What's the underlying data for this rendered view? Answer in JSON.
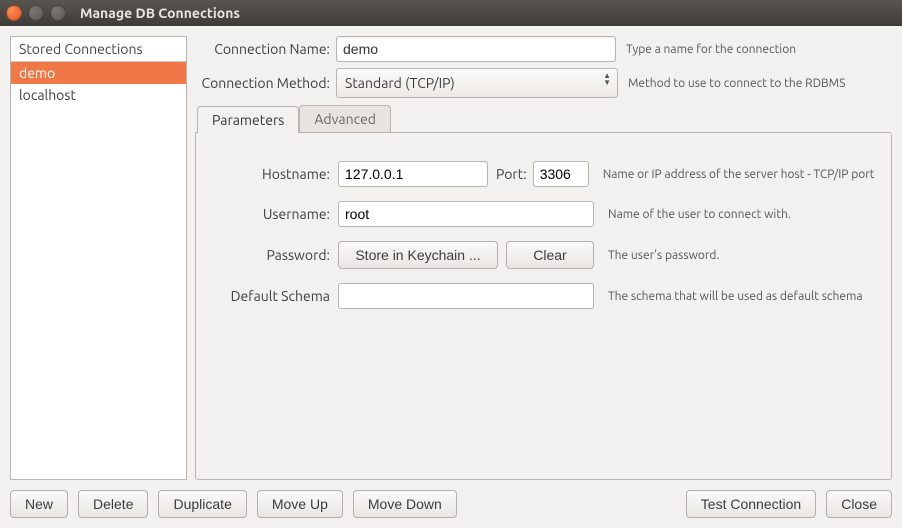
{
  "window": {
    "title": "Manage DB Connections"
  },
  "sidebar": {
    "header": "Stored Connections",
    "items": [
      "demo",
      "localhost"
    ],
    "selected_index": 0
  },
  "form": {
    "name": {
      "label": "Connection Name:",
      "value": "demo",
      "hint": "Type a name for the connection"
    },
    "method": {
      "label": "Connection Method:",
      "value": "Standard (TCP/IP)",
      "hint": "Method to use to connect to the RDBMS"
    }
  },
  "tabs": [
    "Parameters",
    "Advanced"
  ],
  "params": {
    "hostname": {
      "label": "Hostname:",
      "value": "127.0.0.1",
      "hint": "Name or IP address of the server host - TCP/IP port"
    },
    "port": {
      "label": "Port:",
      "value": "3306"
    },
    "username": {
      "label": "Username:",
      "value": "root",
      "hint": "Name of the user to connect with."
    },
    "password": {
      "label": "Password:",
      "store_btn": "Store in Keychain ...",
      "clear_btn": "Clear",
      "hint": "The user's password."
    },
    "schema": {
      "label": "Default Schema",
      "value": "",
      "hint": "The schema that will be used as default schema"
    }
  },
  "footer": {
    "new": "New",
    "delete": "Delete",
    "duplicate": "Duplicate",
    "move_up": "Move Up",
    "move_down": "Move Down",
    "test": "Test Connection",
    "close": "Close"
  }
}
